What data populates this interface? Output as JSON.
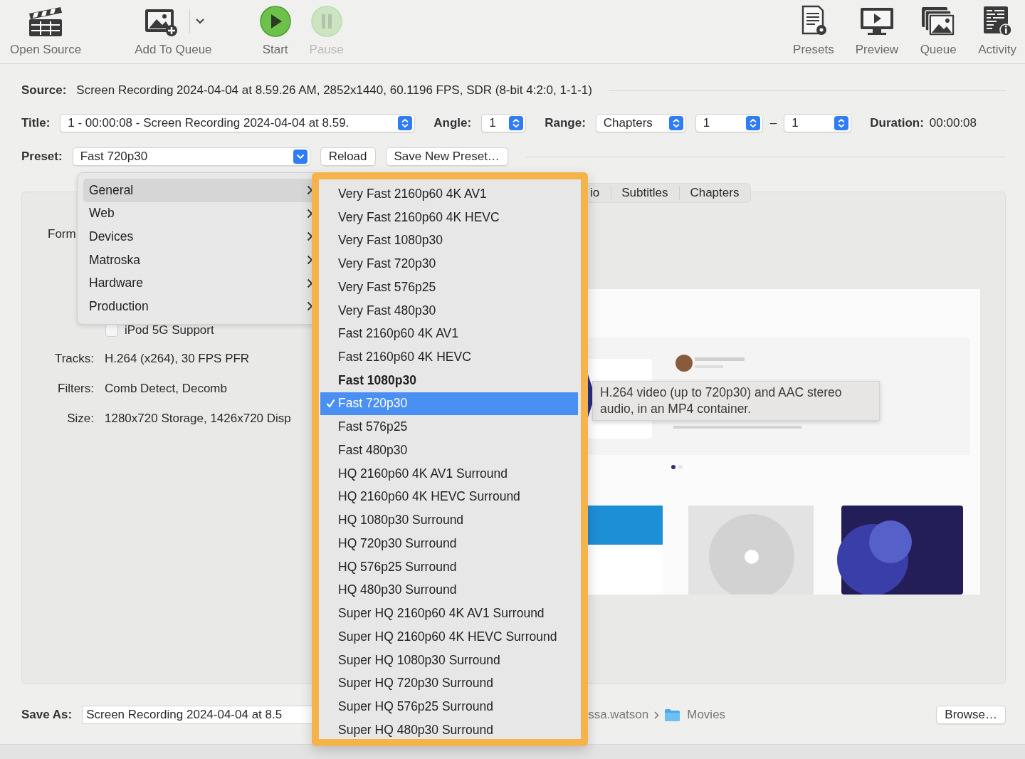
{
  "toolbar": {
    "left": [
      {
        "label": "Open Source",
        "kind": "clapper",
        "disabled": false,
        "dropdown": false
      },
      {
        "label": "Add To Queue",
        "kind": "add-photo",
        "disabled": false,
        "dropdown": true
      },
      {
        "label": "Start",
        "kind": "play",
        "disabled": false,
        "dropdown": false
      },
      {
        "label": "Pause",
        "kind": "pause",
        "disabled": true,
        "dropdown": false
      }
    ],
    "right": [
      {
        "label": "Presets",
        "kind": "presets",
        "disabled": false,
        "dropdown": false
      },
      {
        "label": "Preview",
        "kind": "monitor",
        "disabled": false,
        "dropdown": false
      },
      {
        "label": "Queue",
        "kind": "photo-stack",
        "disabled": false,
        "dropdown": false
      },
      {
        "label": "Activity",
        "kind": "activity",
        "disabled": false,
        "dropdown": false
      }
    ]
  },
  "source": {
    "label": "Source:",
    "value": "Screen Recording 2024-04-04 at 8.59.26 AM, 2852x1440, 60.1196 FPS, SDR (8-bit 4:2:0, 1-1-1)"
  },
  "title": {
    "label": "Title:",
    "value": "1 - 00:00:08 - Screen Recording 2024-04-04 at 8.59."
  },
  "angle": {
    "label": "Angle:",
    "value": "1"
  },
  "range": {
    "label": "Range:",
    "mode": "Chapters",
    "start": "1",
    "separator": "–",
    "end": "1"
  },
  "duration": {
    "label": "Duration:",
    "value": "00:00:08"
  },
  "preset": {
    "label": "Preset:",
    "value": "Fast 720p30",
    "buttons": [
      "Reload",
      "Save New Preset…"
    ]
  },
  "tabs": [
    {
      "label": "io"
    },
    {
      "label": "Subtitles"
    },
    {
      "label": "Chapters"
    }
  ],
  "summary": {
    "format_label": "Form",
    "ipod": {
      "label": "iPod 5G Support",
      "checked": false
    },
    "rows": [
      {
        "label": "Tracks:",
        "value": "H.264 (x264), 30 FPS PFR"
      },
      {
        "label": "Filters:",
        "value": "Comb Detect, Decomb"
      },
      {
        "label": "Size:",
        "value": "1280x720 Storage, 1426x720 Disp"
      }
    ]
  },
  "tooltip": "H.264 video (up to 720p30) and AAC stereo audio, in an MP4 container.",
  "save": {
    "label": "Save As:",
    "value": "Screen Recording 2024-04-04 at 8.5",
    "path": [
      "ssa.watson",
      "Movies"
    ],
    "browse": "Browse…"
  },
  "category_menu": [
    {
      "label": "General",
      "selected": true
    },
    {
      "label": "Web",
      "selected": false
    },
    {
      "label": "Devices",
      "selected": false
    },
    {
      "label": "Matroska",
      "selected": false
    },
    {
      "label": "Hardware",
      "selected": false
    },
    {
      "label": "Production",
      "selected": false
    }
  ],
  "preset_menu": [
    {
      "label": "Very Fast 2160p60 4K AV1",
      "selected": false,
      "is_default": false
    },
    {
      "label": "Very Fast 2160p60 4K HEVC",
      "selected": false,
      "is_default": false
    },
    {
      "label": "Very Fast 1080p30",
      "selected": false,
      "is_default": false
    },
    {
      "label": "Very Fast 720p30",
      "selected": false,
      "is_default": false
    },
    {
      "label": "Very Fast 576p25",
      "selected": false,
      "is_default": false
    },
    {
      "label": "Very Fast 480p30",
      "selected": false,
      "is_default": false
    },
    {
      "label": "Fast 2160p60 4K AV1",
      "selected": false,
      "is_default": false
    },
    {
      "label": "Fast 2160p60 4K HEVC",
      "selected": false,
      "is_default": false
    },
    {
      "label": "Fast 1080p30",
      "selected": false,
      "is_default": true
    },
    {
      "label": "Fast 720p30",
      "selected": true,
      "is_default": false
    },
    {
      "label": "Fast 576p25",
      "selected": false,
      "is_default": false
    },
    {
      "label": "Fast 480p30",
      "selected": false,
      "is_default": false
    },
    {
      "label": "HQ 2160p60 4K AV1 Surround",
      "selected": false,
      "is_default": false
    },
    {
      "label": "HQ 2160p60 4K HEVC Surround",
      "selected": false,
      "is_default": false
    },
    {
      "label": "HQ 1080p30 Surround",
      "selected": false,
      "is_default": false
    },
    {
      "label": "HQ 720p30 Surround",
      "selected": false,
      "is_default": false
    },
    {
      "label": "HQ 576p25 Surround",
      "selected": false,
      "is_default": false
    },
    {
      "label": "HQ 480p30 Surround",
      "selected": false,
      "is_default": false
    },
    {
      "label": "Super HQ 2160p60 4K AV1 Surround",
      "selected": false,
      "is_default": false
    },
    {
      "label": "Super HQ 2160p60 4K HEVC Surround",
      "selected": false,
      "is_default": false
    },
    {
      "label": "Super HQ 1080p30 Surround",
      "selected": false,
      "is_default": false
    },
    {
      "label": "Super HQ 720p30 Surround",
      "selected": false,
      "is_default": false
    },
    {
      "label": "Super HQ 576p25 Surround",
      "selected": false,
      "is_default": false
    },
    {
      "label": "Super HQ 480p30 Surround",
      "selected": false,
      "is_default": false
    }
  ]
}
